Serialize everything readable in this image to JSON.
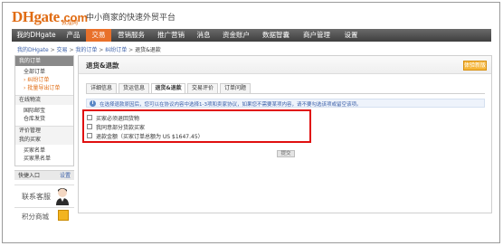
{
  "header": {
    "logo_main": "DHgate",
    "logo_suffix": ".com",
    "logo_cn": "敦煌网",
    "tagline": "中小商家的快速外贸平台"
  },
  "nav": {
    "items": [
      {
        "label": "我的DHgate",
        "w": 54
      },
      {
        "label": "产品",
        "w": 28
      },
      {
        "label": "交易",
        "w": 28,
        "active": true
      },
      {
        "label": "营销服务",
        "w": 44
      },
      {
        "label": "推广营销",
        "w": 44
      },
      {
        "label": "消息",
        "w": 28
      },
      {
        "label": "资金账户",
        "w": 44
      },
      {
        "label": "数据智囊",
        "w": 44
      },
      {
        "label": "商户管理",
        "w": 46
      },
      {
        "label": "设置",
        "w": 30
      }
    ]
  },
  "breadcrumb": {
    "parts": [
      "我的DHgate",
      "交易",
      "我的订单",
      "纠纷订单"
    ],
    "current": "退货&退款"
  },
  "sidebar": {
    "orders_header": "我的订单",
    "order_items": [
      "全部订单",
      "纠纷订单",
      "批量导出订单"
    ],
    "logistics_header": "在线物流",
    "logistics_items": [
      "国际邮宝",
      "仓库发货"
    ],
    "review_header": "评价管理",
    "buyer_header": "我的买家",
    "buyer_items": [
      "买家名单",
      "买家黑名单"
    ],
    "quick_entry": "快捷入口",
    "settings": "设置",
    "support": "联系客服",
    "points": "积分商城"
  },
  "main": {
    "title": "退货&退款",
    "feedback": "体验新版",
    "tabs": [
      "详细信息",
      "货运信息",
      "退货&退款",
      "交易评价",
      "订单问题"
    ],
    "active_tab": 2,
    "info_icon": "i",
    "info_text": "在选择退款原因后，您可以在协议内容中选择1-3项和卖家协议，如果您不需要某项内容，请不要勾选该项或留空该项。",
    "options": [
      "买家必须退回货物",
      "我同意部分货款买家",
      "退款金额（买家订单总额为 US $1647.45）"
    ],
    "submit": "提交"
  }
}
